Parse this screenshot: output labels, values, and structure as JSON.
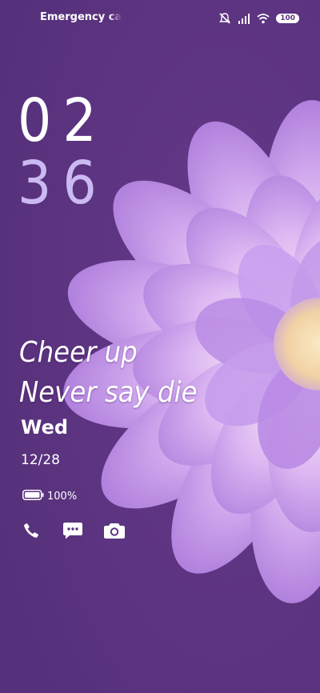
{
  "status_bar": {
    "carrier_text": "Emergency calls only",
    "battery_level": "100"
  },
  "clock": {
    "hours": "02",
    "minutes": "36"
  },
  "quote": {
    "line1": "Cheer up",
    "line2": "Never say die"
  },
  "date": {
    "weekday": "Wed",
    "date": "12/28"
  },
  "battery": {
    "percent_text": "100%",
    "level": 1.0
  },
  "shortcuts": {
    "icons": [
      "phone-icon",
      "message-icon",
      "camera-icon"
    ]
  },
  "colors": {
    "background": "#5c3480",
    "minutes_accent": "#cbb9f3",
    "flower_petal": "#c9a3ec",
    "flower_center": "#f6dfb4"
  }
}
